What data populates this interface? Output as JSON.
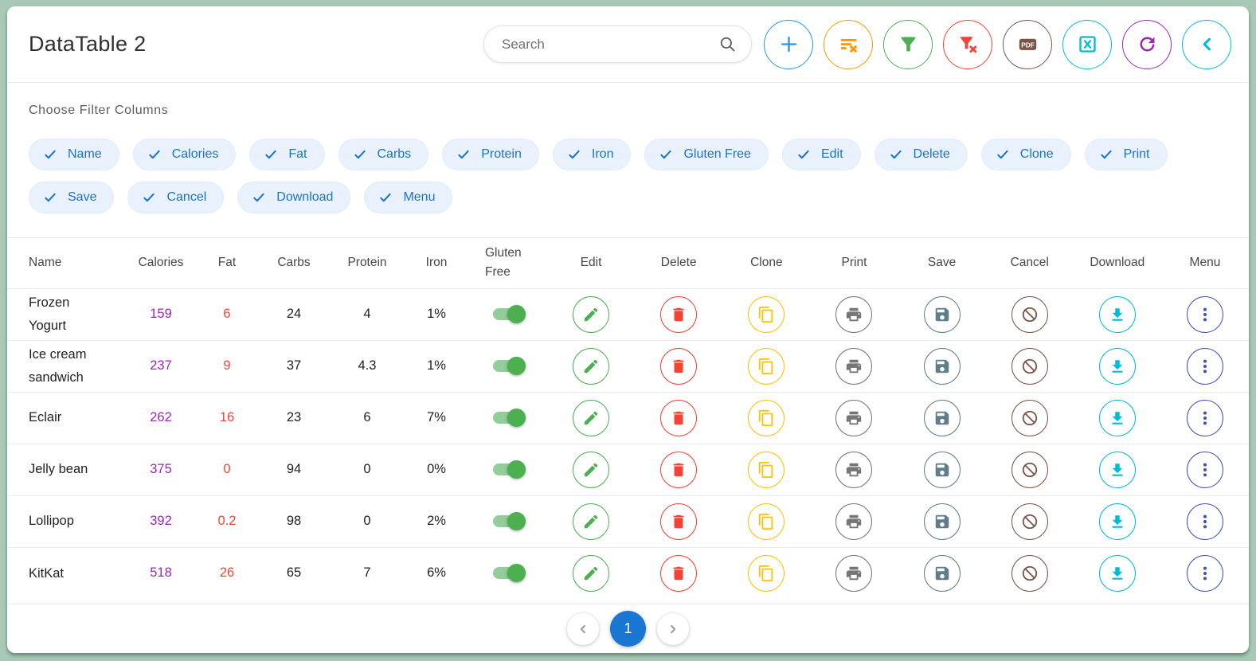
{
  "app": {
    "title": "DataTable 2"
  },
  "search": {
    "placeholder": "Search",
    "icon": "search-icon"
  },
  "toolbar": {
    "buttons": [
      {
        "name": "add-row",
        "icon": "plus-icon",
        "color": "#2196f3"
      },
      {
        "name": "clear-sort",
        "icon": "clear-sort-icon",
        "color": "#ff9800"
      },
      {
        "name": "filter",
        "icon": "filter-icon",
        "color": "#4caf50"
      },
      {
        "name": "clear-filter",
        "icon": "filter-x-icon",
        "color": "#f44336"
      },
      {
        "name": "export-pdf",
        "icon": "pdf-icon",
        "color": "#795548"
      },
      {
        "name": "export-excel",
        "icon": "excel-icon",
        "color": "#00bcd4"
      },
      {
        "name": "refresh",
        "icon": "refresh-icon",
        "color": "#9c27b0"
      },
      {
        "name": "collapse",
        "icon": "chevron-left-icon",
        "color": "#00bcd4"
      }
    ]
  },
  "filter_section": {
    "label": "Choose Filter Columns",
    "chip_icon": "check-icon",
    "chips": [
      "Name",
      "Calories",
      "Fat",
      "Carbs",
      "Protein",
      "Iron",
      "Gluten Free",
      "Edit",
      "Delete",
      "Clone",
      "Print",
      "Save",
      "Cancel",
      "Download",
      "Menu"
    ]
  },
  "table": {
    "columns": [
      {
        "key": "name",
        "label": "Name"
      },
      {
        "key": "calories",
        "label": "Calories"
      },
      {
        "key": "fat",
        "label": "Fat"
      },
      {
        "key": "carbs",
        "label": "Carbs"
      },
      {
        "key": "protein",
        "label": "Protein"
      },
      {
        "key": "iron",
        "label": "Iron"
      },
      {
        "key": "gluten_free",
        "label": "Gluten Free"
      },
      {
        "key": "edit",
        "label": "Edit"
      },
      {
        "key": "delete",
        "label": "Delete"
      },
      {
        "key": "clone",
        "label": "Clone"
      },
      {
        "key": "print",
        "label": "Print"
      },
      {
        "key": "save",
        "label": "Save"
      },
      {
        "key": "cancel",
        "label": "Cancel"
      },
      {
        "key": "download",
        "label": "Download"
      },
      {
        "key": "menu",
        "label": "Menu"
      }
    ],
    "value_colors": {
      "calories": "#9c27b0",
      "fat": "#f44336",
      "default": "#1f1f1f"
    },
    "toggle_colors": {
      "track": "#93cd9a",
      "knob": "#4caf50"
    },
    "actions": [
      {
        "name": "edit",
        "icon": "pencil-icon",
        "color": "#4caf50"
      },
      {
        "name": "delete",
        "icon": "trash-icon",
        "color": "#f44336"
      },
      {
        "name": "clone",
        "icon": "copy-icon",
        "color": "#ffc107"
      },
      {
        "name": "print",
        "icon": "printer-icon",
        "color": "#757575"
      },
      {
        "name": "save",
        "icon": "floppy-icon",
        "color": "#607d8b"
      },
      {
        "name": "cancel",
        "icon": "ban-icon",
        "color": "#795548"
      },
      {
        "name": "download",
        "icon": "download-icon",
        "color": "#00bcd4"
      },
      {
        "name": "menu",
        "icon": "kebab-icon",
        "color": "#3f51b5"
      }
    ],
    "rows": [
      {
        "name": "Frozen Yogurt",
        "calories": "159",
        "fat": "6",
        "carbs": "24",
        "protein": "4",
        "iron": "1%",
        "gluten_free": true
      },
      {
        "name": "Ice cream sandwich",
        "calories": "237",
        "fat": "9",
        "carbs": "37",
        "protein": "4.3",
        "iron": "1%",
        "gluten_free": true
      },
      {
        "name": "Eclair",
        "calories": "262",
        "fat": "16",
        "carbs": "23",
        "protein": "6",
        "iron": "7%",
        "gluten_free": true
      },
      {
        "name": "Jelly bean",
        "calories": "375",
        "fat": "0",
        "carbs": "94",
        "protein": "0",
        "iron": "0%",
        "gluten_free": true
      },
      {
        "name": "Lollipop",
        "calories": "392",
        "fat": "0.2",
        "carbs": "98",
        "protein": "0",
        "iron": "2%",
        "gluten_free": true
      },
      {
        "name": "KitKat",
        "calories": "518",
        "fat": "26",
        "carbs": "65",
        "protein": "7",
        "iron": "6%",
        "gluten_free": true
      }
    ]
  },
  "pagination": {
    "prev_icon": "chevron-left-icon",
    "next_icon": "chevron-right-icon",
    "current_page": "1",
    "active_color": "#1976d2"
  }
}
